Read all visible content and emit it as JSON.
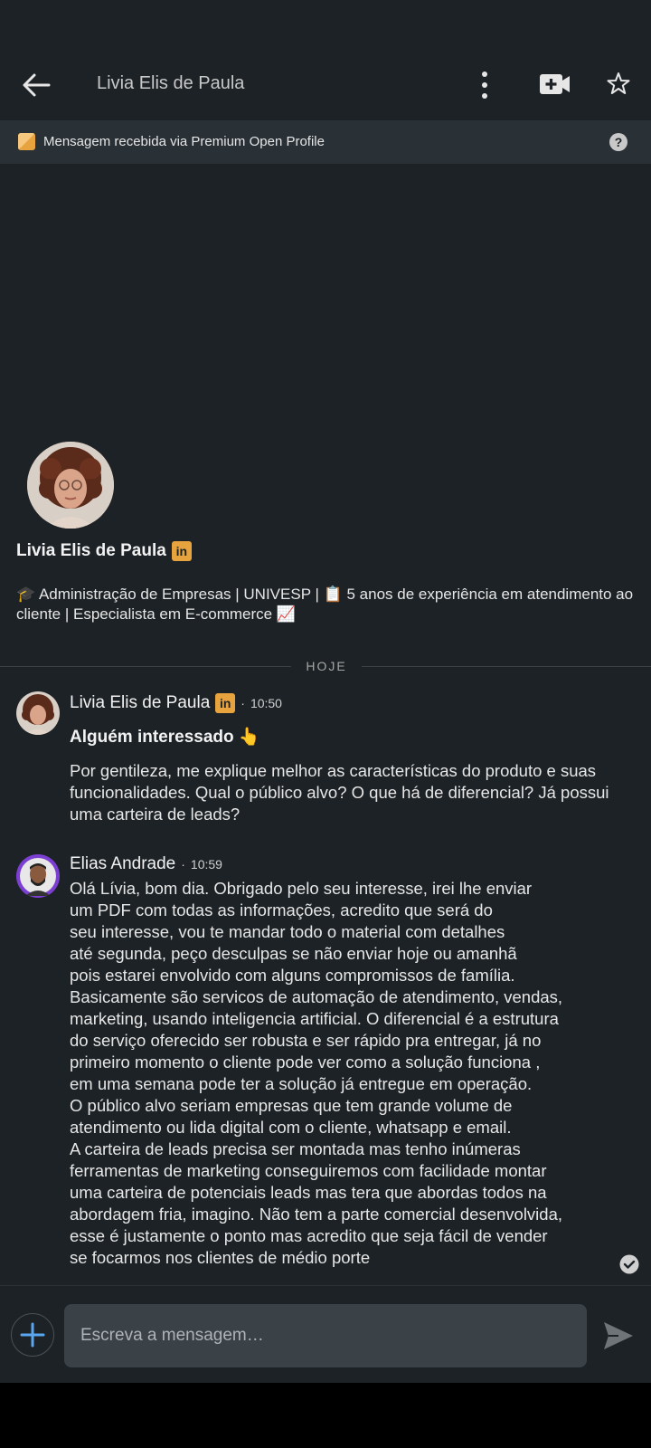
{
  "header": {
    "title": "Livia Elis de Paula"
  },
  "banner": {
    "text": "Mensagem recebida via Premium Open Profile"
  },
  "profile": {
    "name": "Livia Elis de Paula",
    "badge": "in",
    "headline": "🎓 Administração de Empresas | UNIVESP | 📋 5 anos de experiência em atendimento ao cliente | Especialista em E-commerce 📈"
  },
  "divider": {
    "label": "HOJE"
  },
  "messages": [
    {
      "sender": "Livia Elis de Paula",
      "badge": "in",
      "time": "10:50",
      "subject": "Alguém interessado 👆",
      "body": "Por gentileza, me explique melhor as características do produto e suas funcionalidades. Qual o público alvo? O que há de diferencial? Já possui uma carteira de leads?"
    },
    {
      "sender": "Elias Andrade",
      "time": "10:59",
      "body": "Olá Lívia, bom dia. Obrigado pelo seu interesse, irei lhe enviar\num PDF com todas as informações, acredito que será do\nseu interesse, vou te mandar todo o material com detalhes\naté segunda, peço desculpas se não enviar hoje ou amanhã\npois estarei envolvido com alguns compromissos de família.\nBasicamente são servicos de automação de atendimento, vendas,\nmarketing, usando inteligencia artificial. O diferencial é a estrutura\ndo serviço oferecido ser robusta e ser rápido pra entregar, já no\nprimeiro momento o cliente pode ver como a solução funciona ,\nem uma semana pode ter a solução já entregue em operação.\nO público alvo seriam empresas que tem grande volume de\natendimento ou lida digital com o cliente, whatsapp e email.\nA carteira de leads precisa ser montada mas tenho inúmeras\nferramentas de marketing conseguiremos com facilidade montar\numa carteira de potenciais leads mas tera que abordas todos na\nabordagem fria, imagino. Não tem a parte comercial desenvolvida,\nesse é justamente o ponto mas acredito que seja fácil de vender\nse focarmos nos clientes de médio porte"
    }
  ],
  "composer": {
    "placeholder": "Escreva a mensagem…"
  },
  "colors": {
    "background": "#1d2226",
    "banner": "#293036",
    "accent_gold": "#e7a33e",
    "input": "#3a4147"
  },
  "icons": [
    "back-arrow-icon",
    "more-vertical-icon",
    "video-call-icon",
    "star-icon",
    "premium-icon",
    "help-icon",
    "linkedin-icon",
    "check-circle-icon",
    "plus-icon",
    "send-icon"
  ]
}
